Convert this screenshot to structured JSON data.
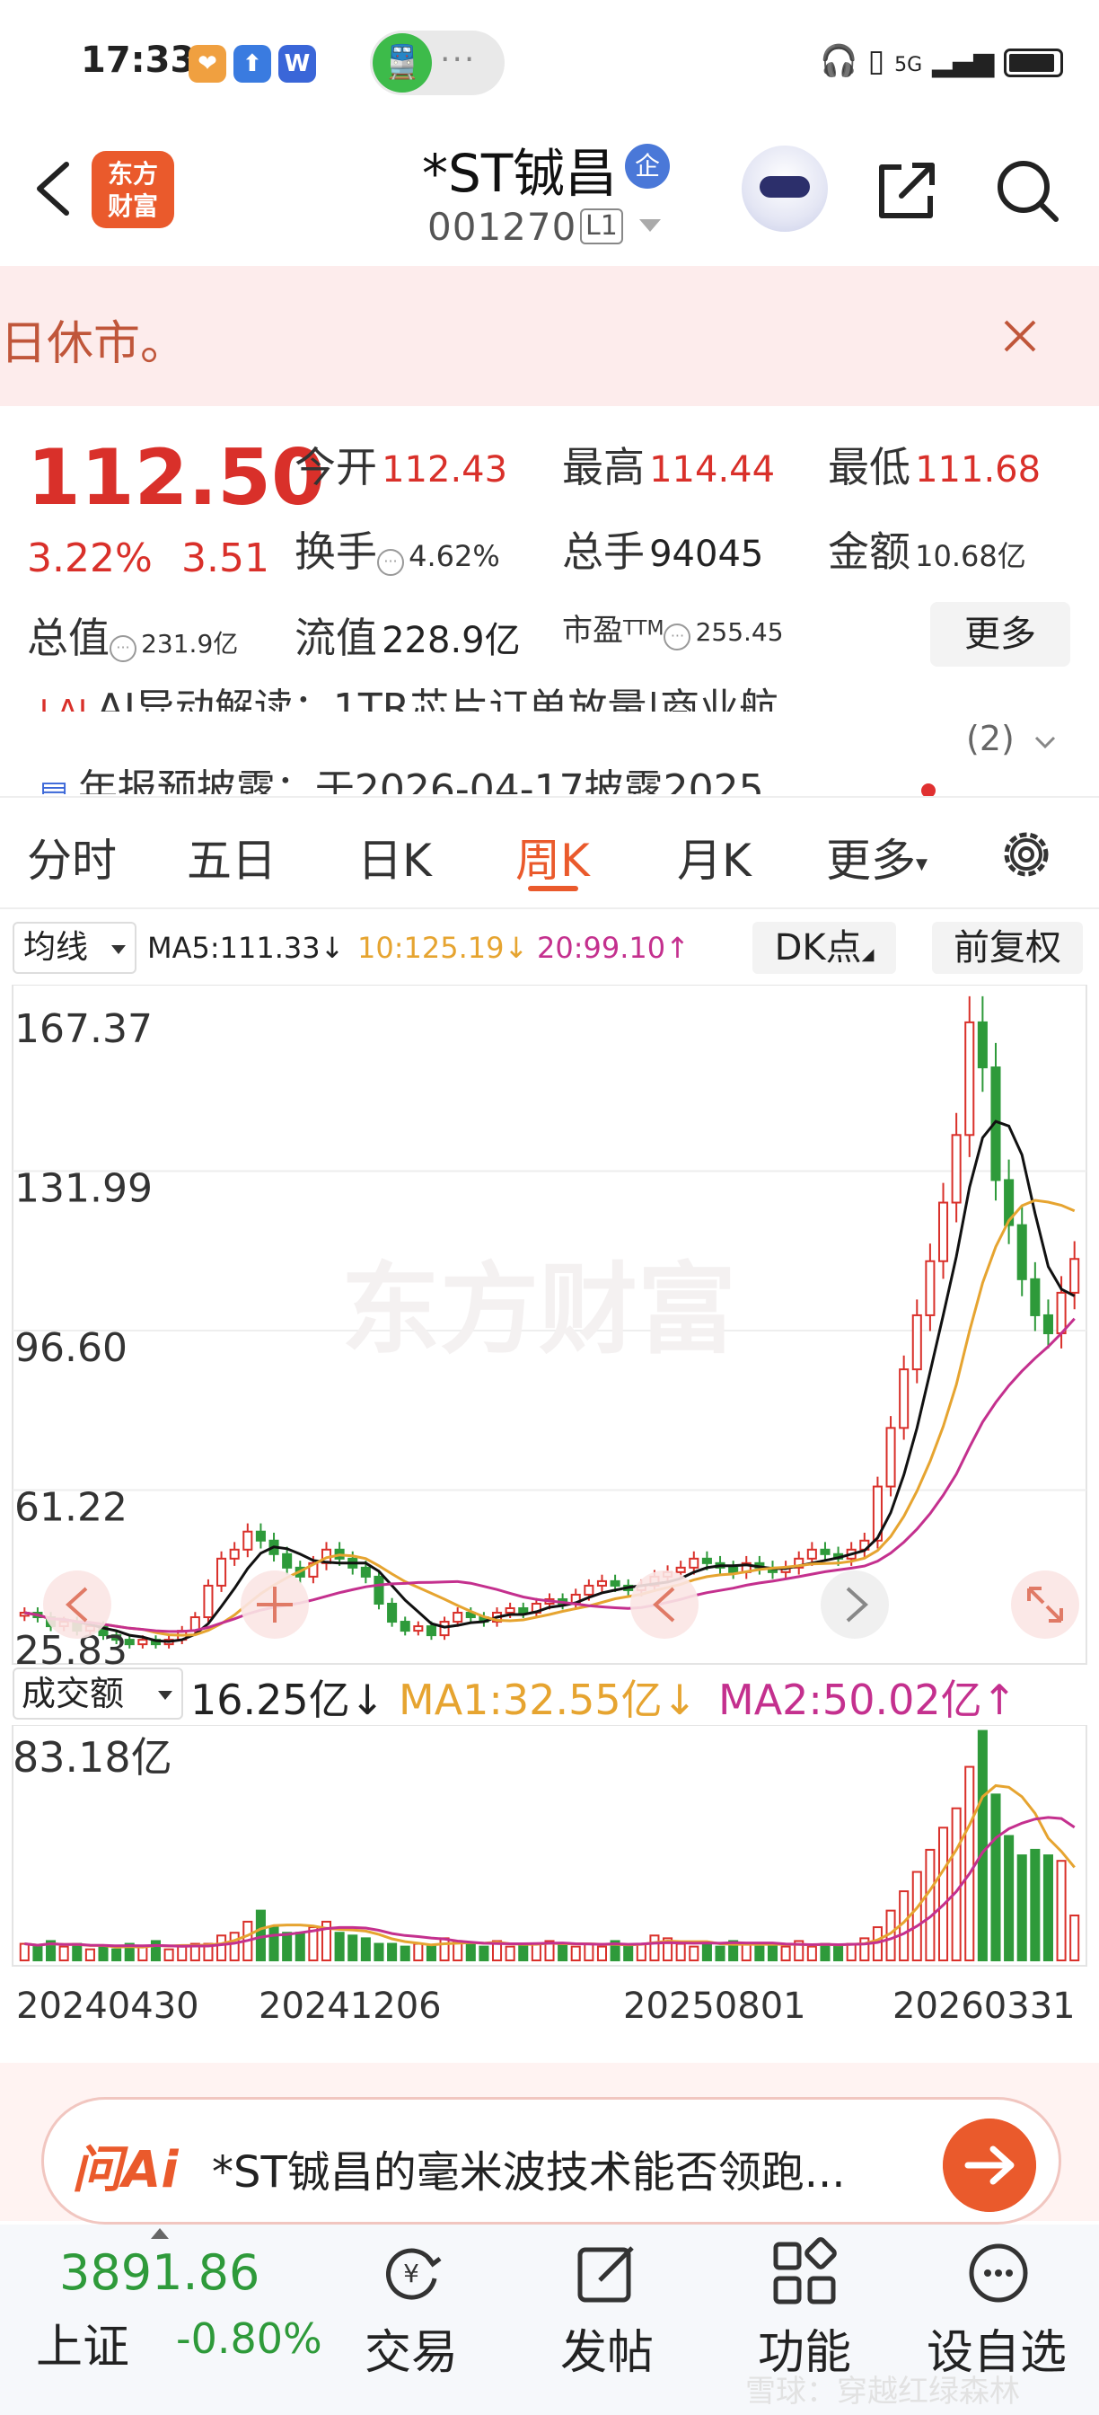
{
  "status_bar": {
    "time": "17:33",
    "signal_text": "5G"
  },
  "header": {
    "stock_name": "*ST铖昌",
    "name_badge": "企",
    "stock_code": "001270",
    "level_badge": "L1",
    "logo_text_1": "东方",
    "logo_text_2": "财富"
  },
  "banner": {
    "text": "日休市。"
  },
  "quote": {
    "price": "112.50",
    "change_pct": "3.22%",
    "change": "3.51",
    "open_label": "今开",
    "open_value": "112.43",
    "high_label": "最高",
    "high_value": "114.44",
    "low_label": "最低",
    "low_value": "111.68",
    "turnover_label": "换手",
    "turnover_value": "4.62%",
    "volume_label": "总手",
    "volume_value": "94045",
    "amount_label": "金额",
    "amount_value": "10.68亿",
    "mktcap_label": "总值",
    "mktcap_value": "231.9亿",
    "float_label": "流值",
    "float_value": "228.9亿",
    "pe_label": "市盈",
    "pe_sup": "TTM",
    "pe_value": "255.45",
    "more_button": "更多"
  },
  "news": {
    "item1": "AI异动解读：1TR芯片订单放量|商业航...",
    "count": "(2)",
    "item2": "年报预披露：于2026-04-17披露2025"
  },
  "tabs": [
    {
      "label": "分时",
      "active": false
    },
    {
      "label": "五日",
      "active": false
    },
    {
      "label": "日K",
      "active": false
    },
    {
      "label": "周K",
      "active": true
    },
    {
      "label": "月K",
      "active": false
    },
    {
      "label": "更多",
      "active": false
    }
  ],
  "ma_row": {
    "selector": "均线",
    "ma5": "MA5:111.33↓",
    "ma10": "10:125.19↓",
    "ma20": "20:99.10↑",
    "dk_button": "DK点",
    "adjust_button": "前复权"
  },
  "volume_row": {
    "selector": "成交额",
    "value": "16.25亿↓",
    "ma1": "MA1:32.55亿↓",
    "ma2": "MA2:50.02亿↑"
  },
  "colors": {
    "up": "#d9302a",
    "down": "#2e9a3a",
    "ma5": "#111111",
    "ma10": "#e6a430",
    "ma20": "#c4308e",
    "accent": "#ea5a2c"
  },
  "chart_data": {
    "type": "candlestick",
    "period": "weekly",
    "price_axis_labels": [
      "167.37",
      "131.99",
      "96.60",
      "61.22",
      "25.83"
    ],
    "ylim": [
      25.83,
      167.37
    ],
    "watermark": "东方财富",
    "weekly_close": [
      34,
      33,
      31,
      32,
      30,
      31,
      29,
      28,
      27,
      28,
      27,
      28,
      30,
      33,
      40,
      46,
      48,
      52,
      50,
      47,
      44,
      42,
      45,
      48,
      46,
      44,
      42,
      36,
      32,
      30,
      31,
      29,
      32,
      34,
      33,
      32,
      34,
      35,
      34,
      36,
      37,
      36,
      38,
      40,
      41,
      40,
      39,
      40,
      42,
      43,
      44,
      46,
      45,
      44,
      43,
      45,
      44,
      43,
      44,
      46,
      48,
      47,
      46,
      48,
      50,
      62,
      75,
      88,
      100,
      112,
      125,
      140,
      165,
      155,
      130,
      120,
      108,
      100,
      96,
      105,
      112.5
    ],
    "volume_axis_label": "83.18亿",
    "volume_ylim": [
      0,
      83.18
    ],
    "weekly_amount": [
      6,
      5,
      7,
      5,
      6,
      4,
      5,
      4,
      6,
      5,
      7,
      4,
      5,
      6,
      6,
      9,
      10,
      14,
      18,
      12,
      10,
      10,
      12,
      14,
      10,
      9,
      8,
      6,
      6,
      5,
      6,
      5,
      8,
      7,
      6,
      5,
      7,
      5,
      6,
      6,
      7,
      6,
      5,
      6,
      5,
      7,
      5,
      6,
      9,
      8,
      6,
      5,
      6,
      5,
      7,
      6,
      5,
      6,
      5,
      7,
      5,
      6,
      5,
      6,
      8,
      12,
      18,
      25,
      32,
      40,
      48,
      55,
      70,
      83,
      60,
      45,
      38,
      40,
      38,
      36,
      16.25
    ],
    "x_labels": [
      "20240430",
      "20241206",
      "20250801",
      "20260331"
    ]
  },
  "ai_bar": {
    "logo": "问Ai",
    "text": "*ST铖昌的毫米波技术能否领跑..."
  },
  "bottom_nav": {
    "index_value": "3891.86",
    "index_name": "上证",
    "index_change": "-0.80%",
    "items": [
      "交易",
      "发帖",
      "功能",
      "设自选"
    ]
  },
  "watermark": "雪球：穿越红绿森林"
}
